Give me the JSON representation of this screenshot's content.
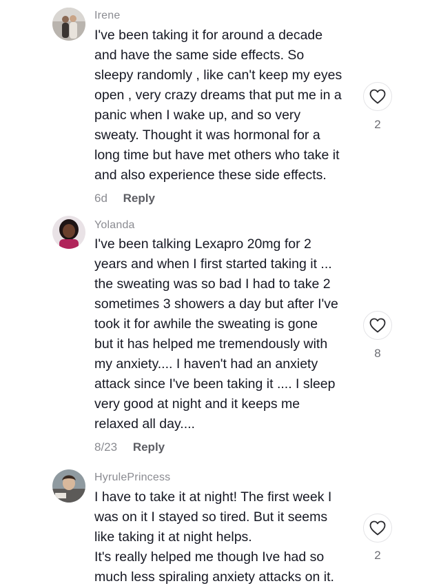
{
  "comments": [
    {
      "username": "Irene",
      "text": "I've been taking it for around a decade\nand have the same side effects. So\nsleepy randomly , like can't keep my eyes\nopen , very crazy dreams that put me in a\npanic when I wake up, and so very\nsweaty. Thought it was hormonal for a\nlong time but have met others who take it\nand also experience these side effects.",
      "date": "6d",
      "reply_label": "Reply",
      "likes": "2",
      "like_icon": "heart-outline-icon"
    },
    {
      "username": "Yolanda",
      "text": "I've been talking Lexapro 20mg for 2\nyears and when I first started taking it ...\nthe sweating was so bad I had to take 2\nsometimes 3 showers a day but after I've\ntook it for awhile the sweating is gone\nbut it has helped me tremendously with\nmy anxiety.... I haven't had an anxiety\nattack since I've been taking it .... I sleep\nvery good at night and it keeps me\nrelaxed all day....",
      "date": "8/23",
      "reply_label": "Reply",
      "likes": "8",
      "like_icon": "heart-outline-icon"
    },
    {
      "username": "HyrulePrincess",
      "text": "I have to take it at night! The first week I\nwas on it I stayed so tired. But it seems\nlike taking it at night helps.\nIt's really helped me though Ive had so\nmuch less spiraling anxiety attacks on it.",
      "likes": "2",
      "like_icon": "heart-outline-icon"
    }
  ]
}
